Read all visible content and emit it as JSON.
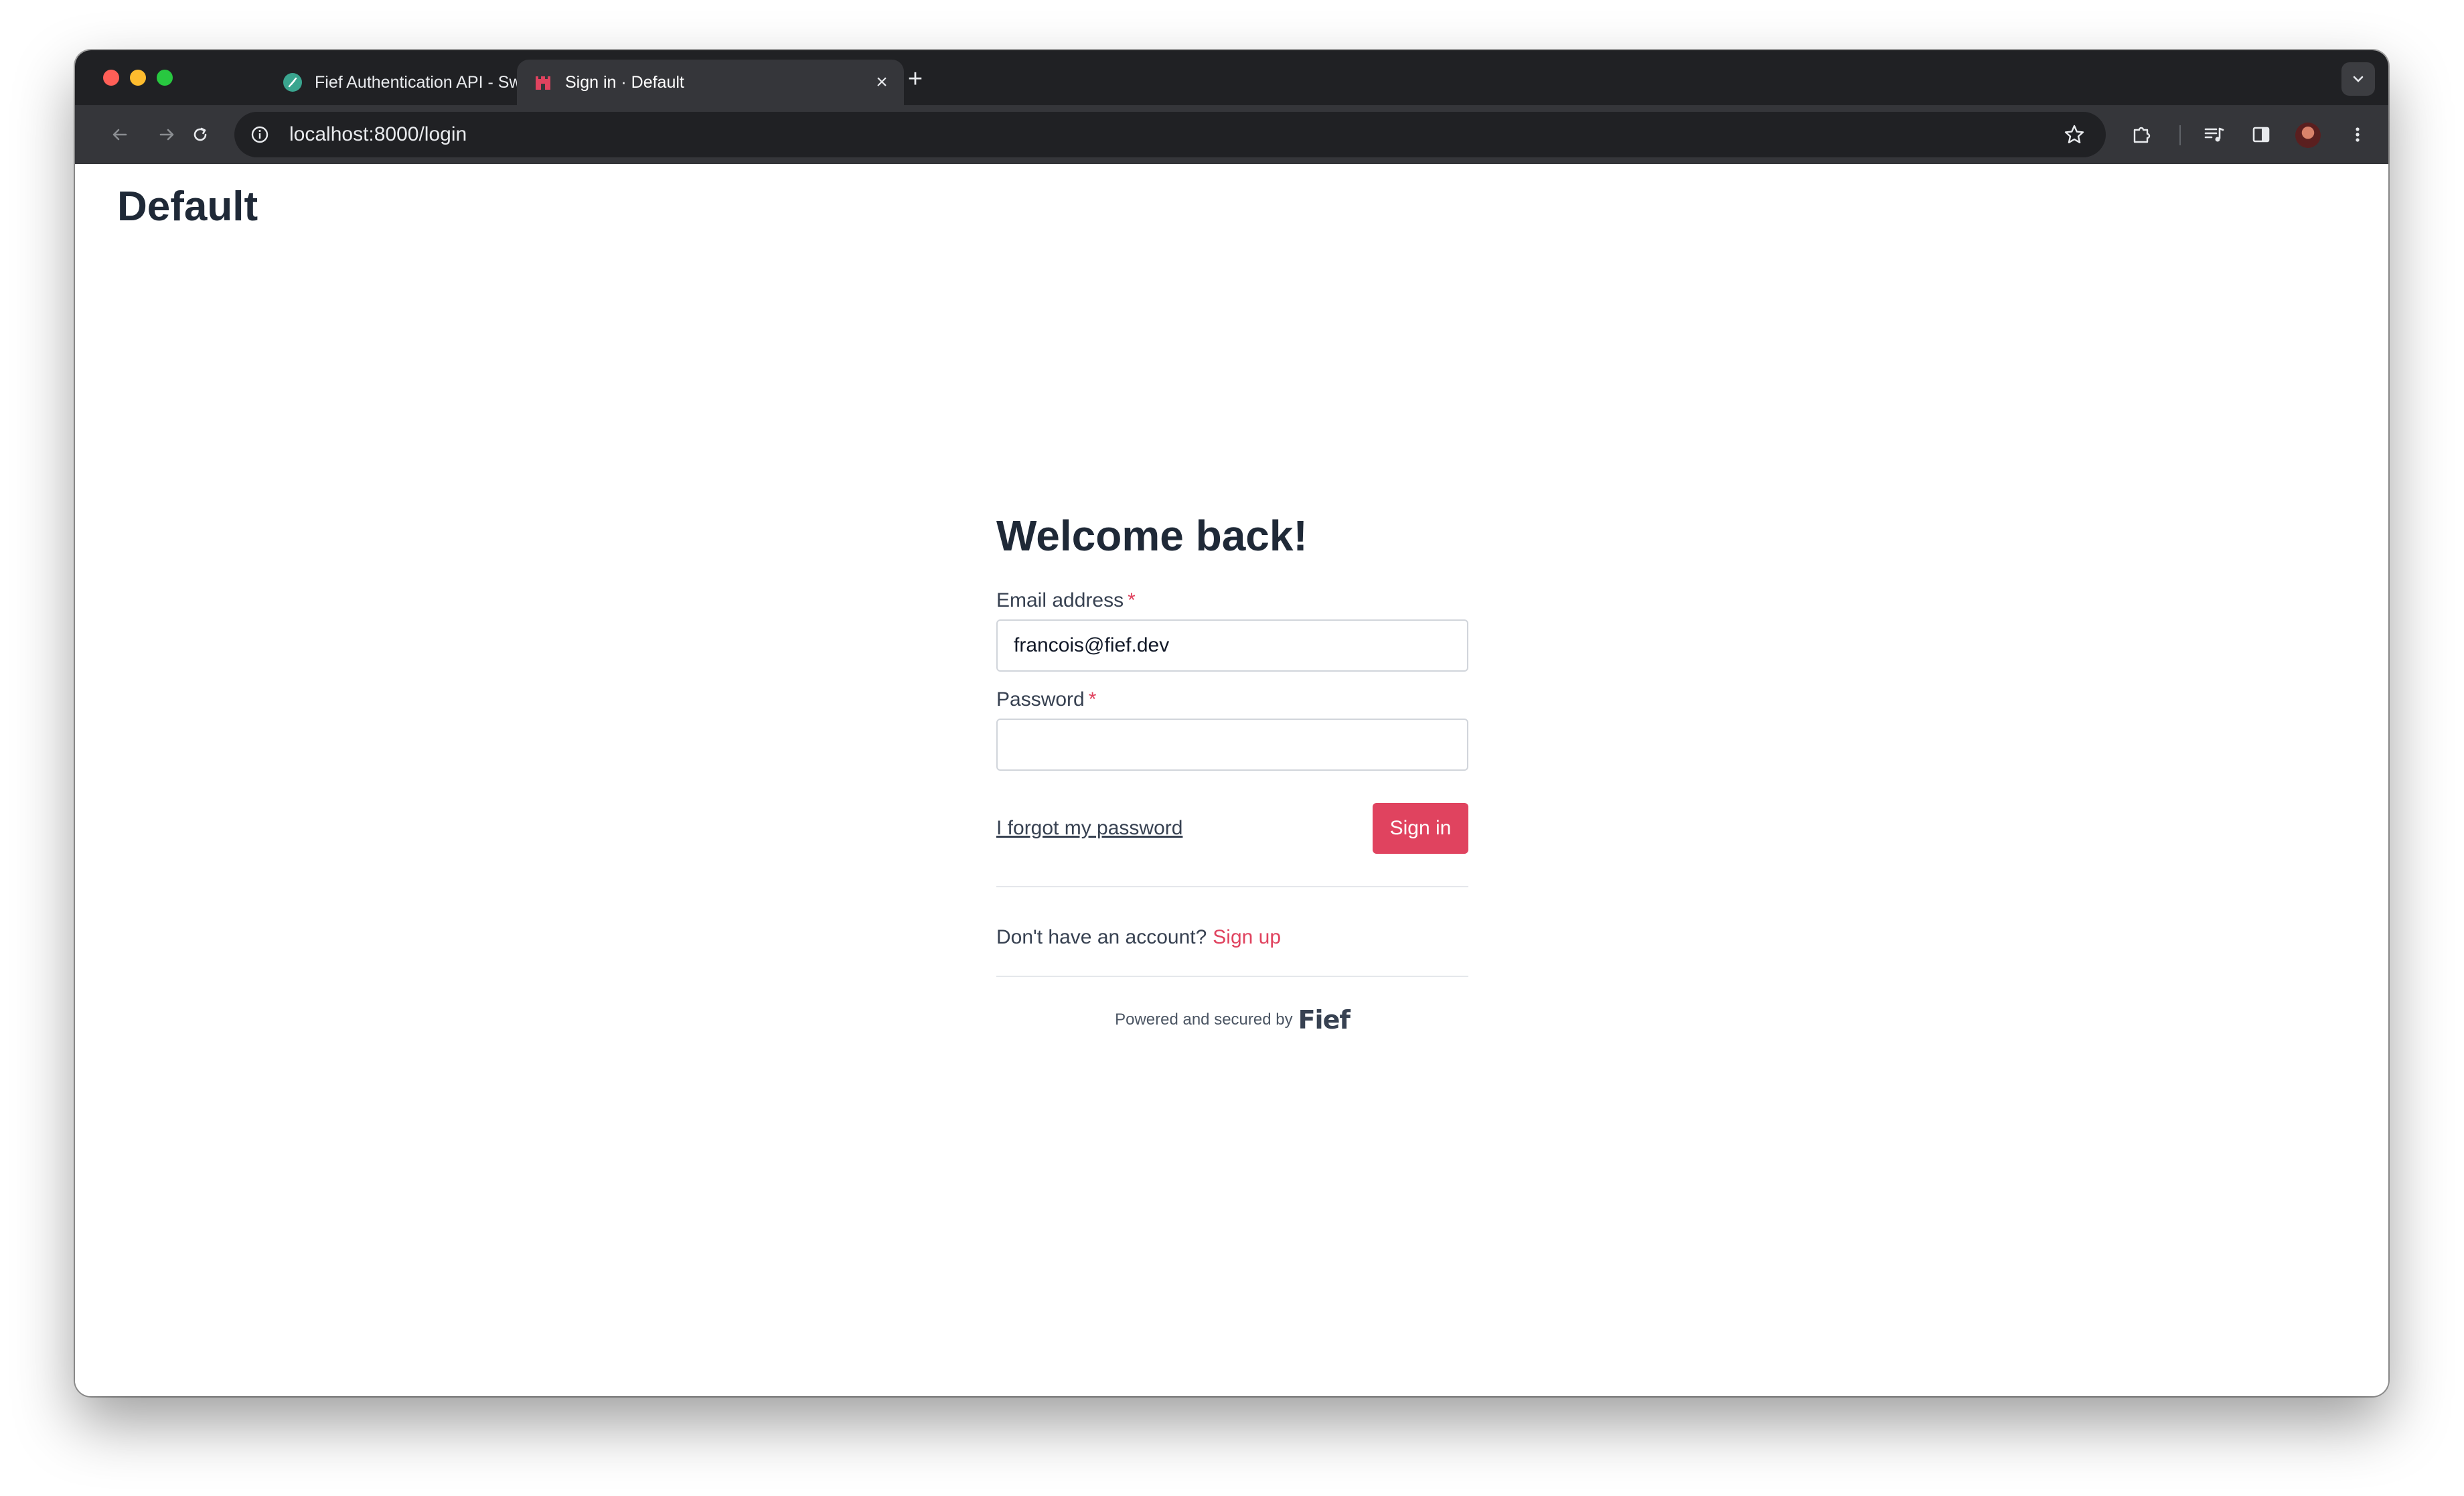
{
  "browser": {
    "tabs": [
      {
        "title": "Fief Authentication API - Swagger UI",
        "favicon": "fief-feather-icon",
        "active": false
      },
      {
        "title": "Sign in · Default",
        "favicon": "fief-castle-icon",
        "active": true
      }
    ],
    "new_tab_icon": "plus-icon",
    "tab_search_icon": "chevron-down-icon",
    "url": "localhost:8000/login",
    "colors": {
      "tabstrip": "#202124",
      "toolbar": "#35363a",
      "omnibox": "#202124"
    }
  },
  "page": {
    "tenant_name": "Default",
    "heading": "Welcome back!",
    "email_label": "Email address",
    "email_value": "francois@fief.dev",
    "password_label": "Password",
    "password_value": "",
    "required_marker": "*",
    "forgot_link": "I forgot my password",
    "signin_button": "Sign in",
    "no_account_text": "Don't have an account?",
    "signup_link": "Sign up",
    "powered_text": "Powered and secured by",
    "brand_logo": "Fief",
    "colors": {
      "primary": "#e0435f",
      "heading": "#1f2937"
    }
  }
}
